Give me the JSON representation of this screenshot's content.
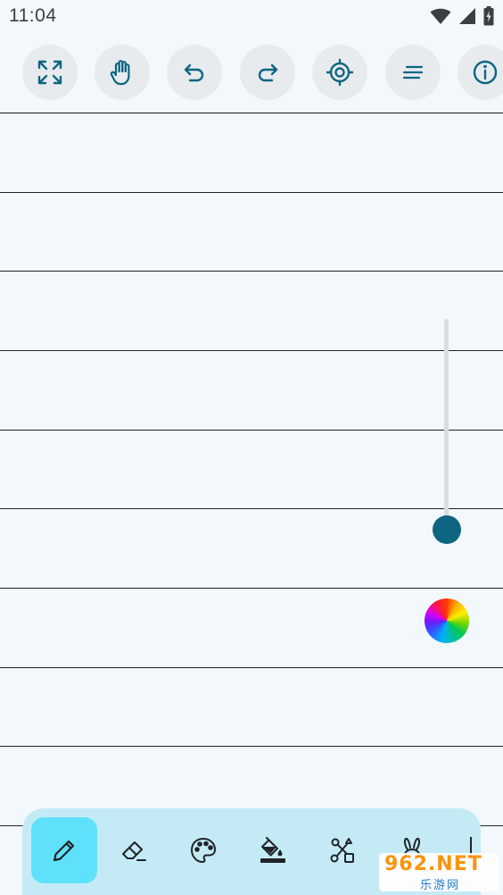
{
  "status_bar": {
    "time": "11:04",
    "icons": [
      "wifi-icon",
      "cell-signal-icon",
      "battery-charging-icon"
    ]
  },
  "toolbar": {
    "buttons": [
      {
        "name": "fullscreen",
        "icon": "expand-arrows-icon"
      },
      {
        "name": "pan",
        "icon": "hand-icon"
      },
      {
        "name": "undo",
        "icon": "undo-icon"
      },
      {
        "name": "redo",
        "icon": "redo-icon"
      },
      {
        "name": "center",
        "icon": "crosshair-target-icon"
      },
      {
        "name": "menu",
        "icon": "text-lines-icon"
      },
      {
        "name": "info",
        "icon": "info-icon"
      }
    ]
  },
  "canvas": {
    "background": "notebook-ruled",
    "line_color": "#1f2326"
  },
  "brush_size_slider": {
    "value": 1.0,
    "thumb_color": "#0e6582"
  },
  "color_picker": {
    "icon": "color-wheel-icon"
  },
  "bottom_tools": {
    "active": "pencil",
    "items": [
      {
        "name": "pencil",
        "icon": "pencil-icon"
      },
      {
        "name": "eraser",
        "icon": "eraser-icon"
      },
      {
        "name": "palette",
        "icon": "palette-icon"
      },
      {
        "name": "fill",
        "icon": "paint-bucket-icon"
      },
      {
        "name": "shapes",
        "icon": "shapes-icon"
      },
      {
        "name": "rabbit",
        "icon": "rabbit-icon"
      }
    ]
  },
  "watermark": {
    "top": "962.NET",
    "bottom": "乐游网"
  },
  "colors": {
    "accent": "#0e6582",
    "active_tool_bg": "#5fe1fb",
    "bottom_bar_bg": "#c4ebf5",
    "button_bg": "#e7ebee"
  }
}
